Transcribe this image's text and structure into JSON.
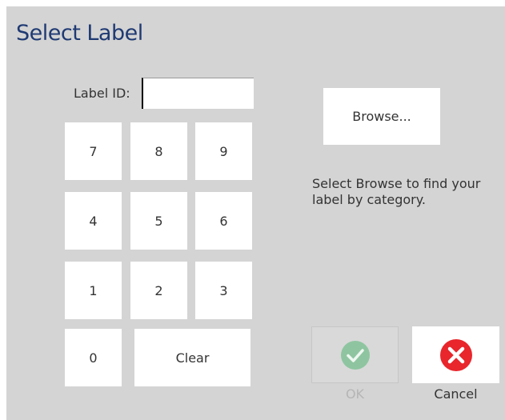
{
  "title": "Select Label",
  "label_id": {
    "label": "Label ID:",
    "value": ""
  },
  "keypad": {
    "k7": "7",
    "k8": "8",
    "k9": "9",
    "k4": "4",
    "k5": "5",
    "k6": "6",
    "k1": "1",
    "k2": "2",
    "k3": "3",
    "k0": "0",
    "clear": "Clear"
  },
  "browse": {
    "label": "Browse..."
  },
  "hint": "Select Browse to find your label by category.",
  "actions": {
    "ok": {
      "label": "OK",
      "icon": "checkmark-icon",
      "color": "#5cb87a",
      "enabled": false
    },
    "cancel": {
      "label": "Cancel",
      "icon": "close-icon",
      "color": "#e8262c"
    }
  }
}
